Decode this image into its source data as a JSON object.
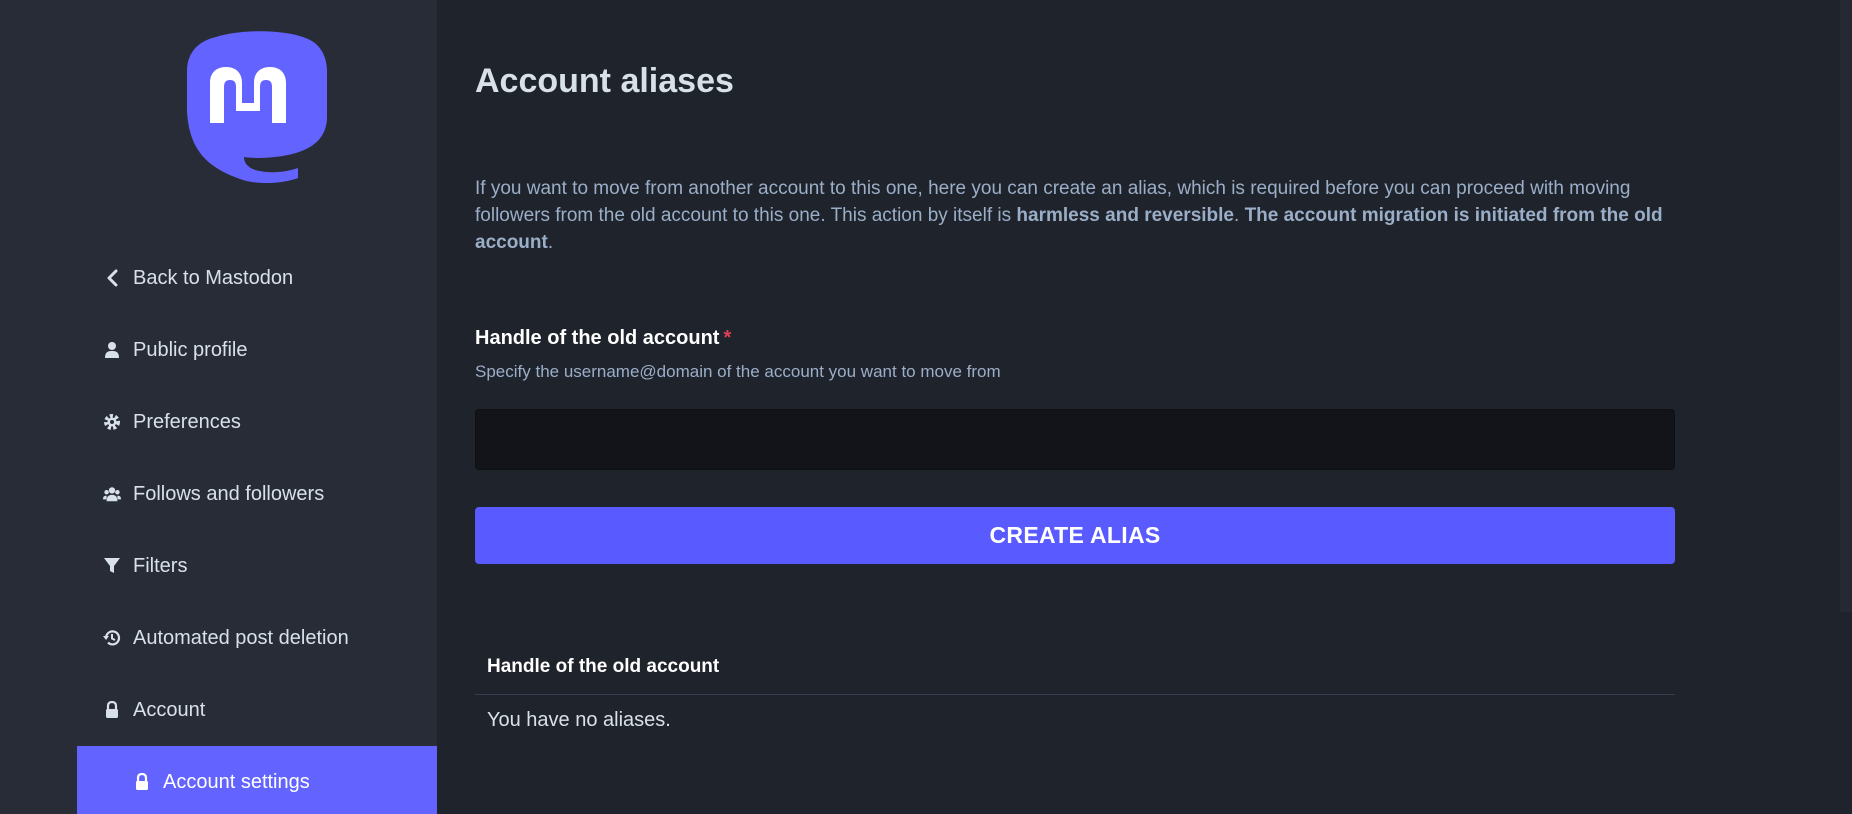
{
  "sidebar": {
    "items": [
      {
        "label": "Back to Mastodon",
        "icon": "chevron-left-icon"
      },
      {
        "label": "Public profile",
        "icon": "user-icon"
      },
      {
        "label": "Preferences",
        "icon": "gear-icon"
      },
      {
        "label": "Follows and followers",
        "icon": "users-icon"
      },
      {
        "label": "Filters",
        "icon": "filter-icon"
      },
      {
        "label": "Automated post deletion",
        "icon": "history-icon"
      },
      {
        "label": "Account",
        "icon": "lock-icon"
      },
      {
        "label": "Account settings",
        "icon": "lock-icon"
      }
    ]
  },
  "main": {
    "title": "Account aliases",
    "intro_plain": "If you want to move from another account to this one, here you can create an alias, which is required before you can proceed with moving followers from the old account to this one. This action by itself is ",
    "intro_bold1": "harmless and reversible",
    "intro_mid": ". ",
    "intro_bold2": "The account migration is initiated from the old account",
    "intro_end": ".",
    "field_label": "Handle of the old account",
    "field_required": "*",
    "field_hint": "Specify the username@domain of the account you want to move from",
    "input_value": "",
    "button_label": "CREATE ALIAS",
    "table_header": "Handle of the old account",
    "table_empty": "You have no aliases."
  },
  "colors": {
    "accent": "#6364ff",
    "button": "#595aff",
    "sidebar_bg": "#282c37",
    "main_bg": "#1f232b",
    "required": "#df405a"
  }
}
